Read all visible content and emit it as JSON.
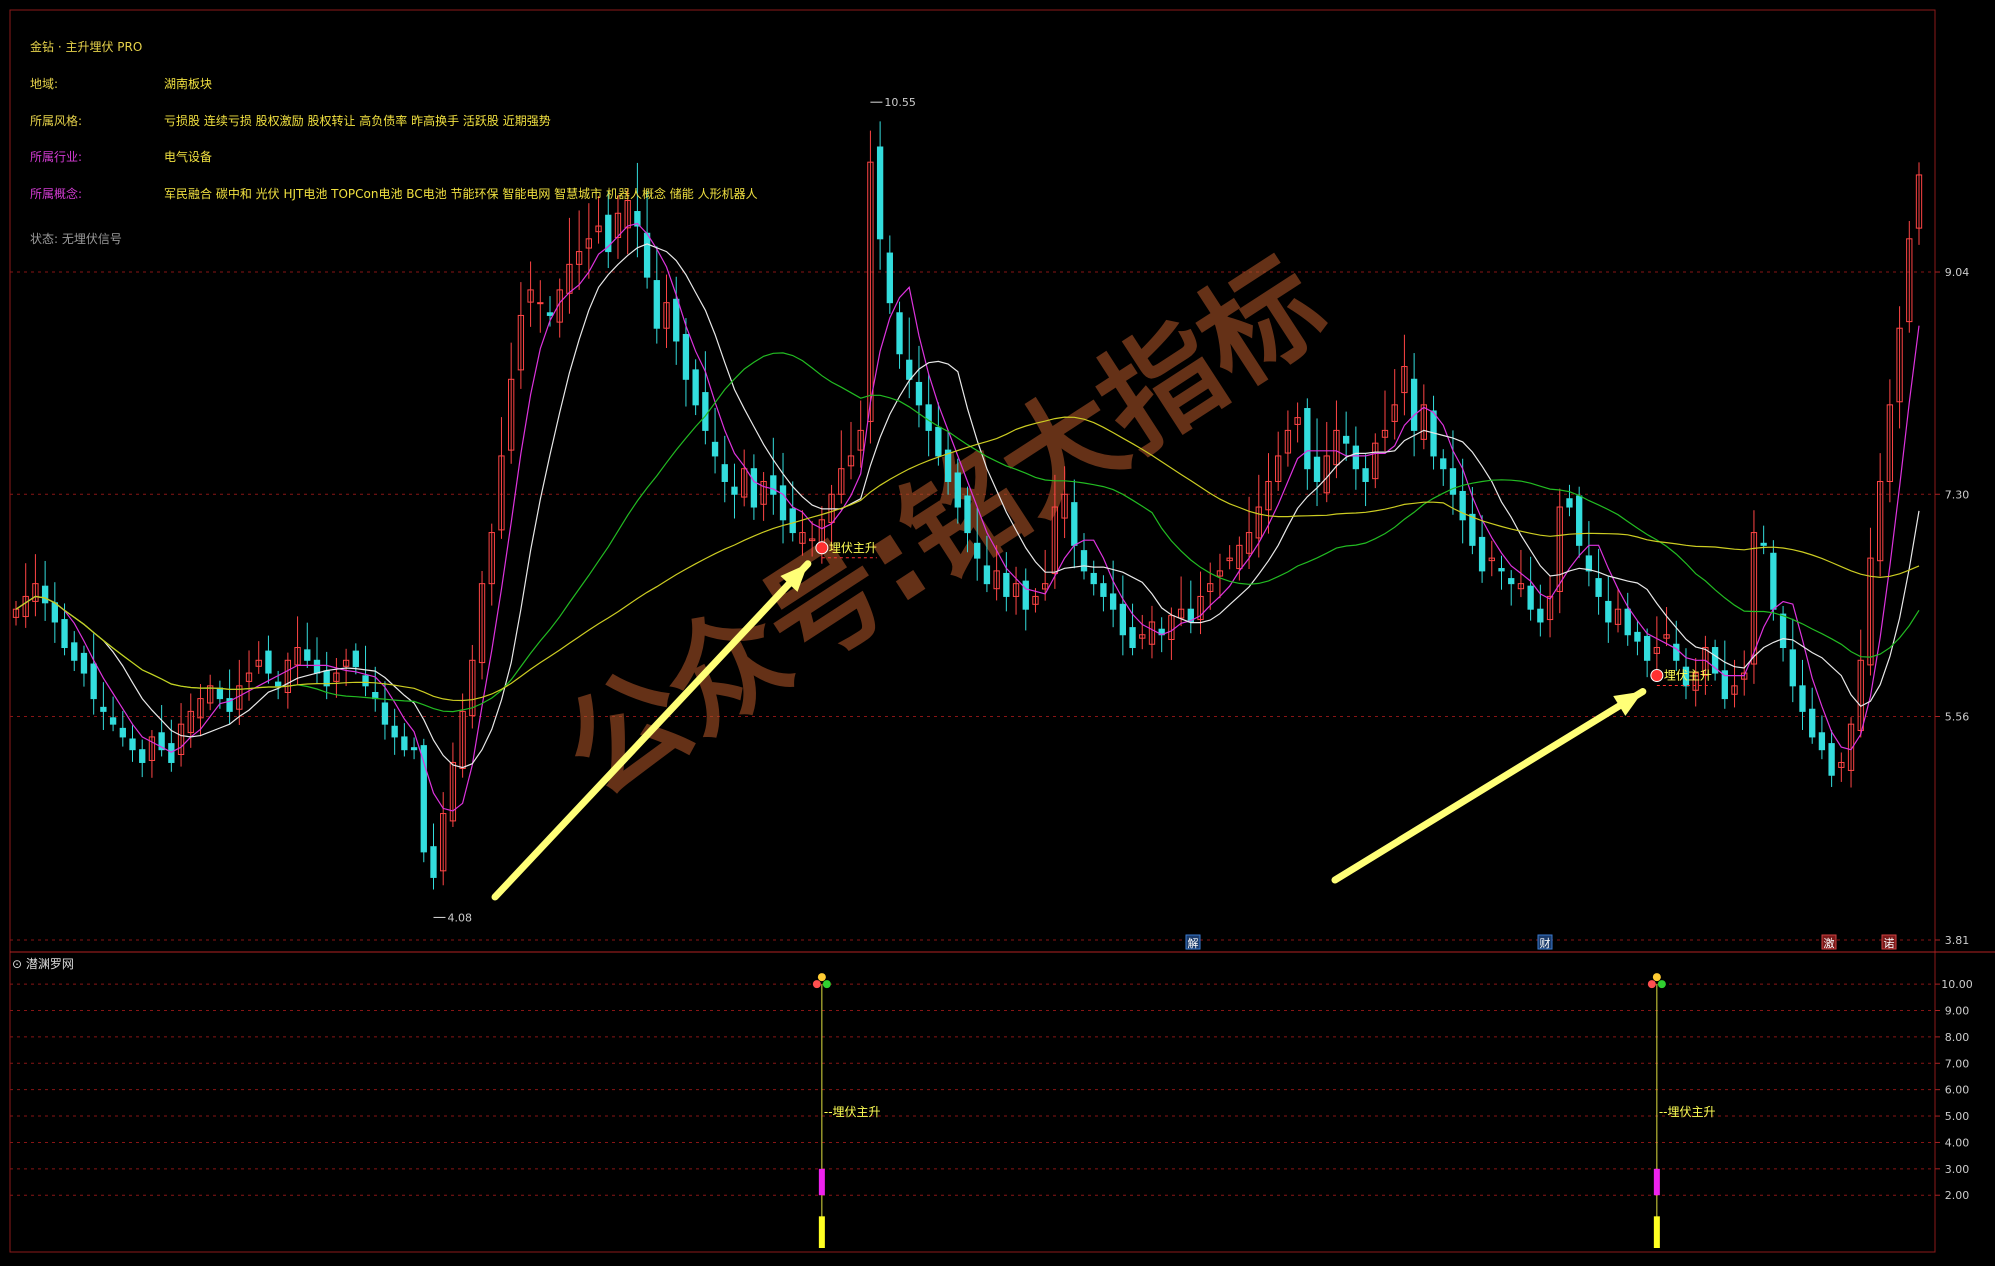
{
  "colors": {
    "background": "#000000",
    "up": "#ff4545",
    "down": "#33dddd",
    "ma_white": "#e8e8e8",
    "ma_magenta": "#dd33dd",
    "ma_green": "#22bb22",
    "ma_yellow": "#cccc22",
    "accent": "#ffff66",
    "grid": "#881515"
  },
  "info_panel": {
    "title": "金钻 · 主升埋伏 PRO",
    "region_label": "地域:",
    "region_value": "湖南板块",
    "style_label": "所属风格:",
    "style_value": "亏损股 连续亏损 股权激励 股权转让 高负债率 昨高换手 活跃股 近期强势",
    "industry_label": "所属行业:",
    "industry_value": "电气设备",
    "concept_label": "所属概念:",
    "concept_value": "军民融合 碳中和 光伏 HJT电池 TOPCon电池 BC电池 节能环保 智能电网 智慧城市 机器人概念 储能 人形机器人",
    "status": "状态: 无埋伏信号"
  },
  "watermark": "公众号:铭大指标",
  "chart_data": [
    {
      "type": "candlestick",
      "title": "",
      "y_axis_ticks": [
        9.04,
        7.3,
        5.56,
        3.81
      ],
      "ylim": [
        3.81,
        10.7
      ],
      "grid": true,
      "high_label": "10.55",
      "low_label": "4.08",
      "signal_label": "埋伏主升",
      "signal_indices": [
        83,
        169
      ],
      "event_markers": [
        "解",
        "财",
        "激",
        "诺"
      ],
      "close_series": [
        6.4,
        6.5,
        6.6,
        6.45,
        6.3,
        6.1,
        6.0,
        5.9,
        5.7,
        5.6,
        5.5,
        5.4,
        5.3,
        5.2,
        5.4,
        5.3,
        5.2,
        5.5,
        5.6,
        5.7,
        5.8,
        5.7,
        5.6,
        5.8,
        5.9,
        6.0,
        5.9,
        5.8,
        6.0,
        6.1,
        6.0,
        5.9,
        5.8,
        5.9,
        6.0,
        5.95,
        5.8,
        5.7,
        5.5,
        5.4,
        5.3,
        5.3,
        4.5,
        4.3,
        4.8,
        5.2,
        5.6,
        6.0,
        6.6,
        7.0,
        7.6,
        8.2,
        8.7,
        8.9,
        8.8,
        8.7,
        8.9,
        9.1,
        9.2,
        9.3,
        9.4,
        9.2,
        9.5,
        9.6,
        9.4,
        9.0,
        8.6,
        8.8,
        8.5,
        8.2,
        8.0,
        7.8,
        7.6,
        7.4,
        7.3,
        7.5,
        7.2,
        7.4,
        7.3,
        7.1,
        7.0,
        7.0,
        6.95,
        7.1,
        7.3,
        7.5,
        7.6,
        7.8,
        9.9,
        9.3,
        8.8,
        8.4,
        8.2,
        8.0,
        7.8,
        7.6,
        7.4,
        7.2,
        7.0,
        6.8,
        6.6,
        6.7,
        6.5,
        6.6,
        6.4,
        6.5,
        6.6,
        7.2,
        7.3,
        6.9,
        6.7,
        6.6,
        6.5,
        6.4,
        6.2,
        6.1,
        6.2,
        6.3,
        6.2,
        6.35,
        6.4,
        6.3,
        6.5,
        6.6,
        6.7,
        6.8,
        6.9,
        7.0,
        7.2,
        7.4,
        7.6,
        7.8,
        7.9,
        7.5,
        7.4,
        7.6,
        7.8,
        7.7,
        7.5,
        7.4,
        7.7,
        7.8,
        8.0,
        8.3,
        7.8,
        8.0,
        7.6,
        7.5,
        7.3,
        7.1,
        6.9,
        6.7,
        6.8,
        6.7,
        6.6,
        6.6,
        6.4,
        6.3,
        6.5,
        7.2,
        7.2,
        6.9,
        6.7,
        6.5,
        6.3,
        6.4,
        6.2,
        6.15,
        6.0,
        6.1,
        6.2,
        6.0,
        5.8,
        5.9,
        6.1,
        5.9,
        5.7,
        5.8,
        5.9,
        7.0,
        6.9,
        6.4,
        6.1,
        5.8,
        5.6,
        5.4,
        5.3,
        5.1,
        5.2,
        5.5,
        6.0,
        6.8,
        7.4,
        8.0,
        8.6,
        9.3,
        9.8
      ]
    },
    {
      "type": "bar",
      "title": "潜渊罗网",
      "y_axis_ticks": [
        10.0,
        9.0,
        8.0,
        7.0,
        6.0,
        5.0,
        4.0,
        3.0,
        2.0
      ],
      "ylim": [
        0,
        10.8
      ],
      "grid": true,
      "signal_label": "埋伏主升",
      "signal_indices": [
        83,
        169
      ],
      "values": [
        10,
        10
      ]
    }
  ]
}
